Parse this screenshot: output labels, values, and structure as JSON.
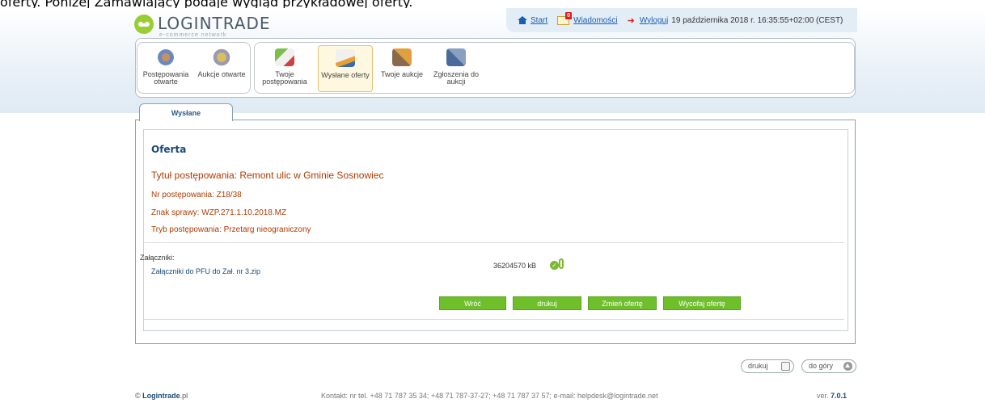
{
  "caption": "oferty. Poniżej Zamawiający podaje wygląd przykładowej oferty.",
  "logo": {
    "name": "LOGINTRADE",
    "tagline": "e-commerce network"
  },
  "top_links": {
    "start": "Start",
    "messages": "Wiadomości",
    "messages_count": "0",
    "logout": "Wyloguj",
    "datetime": "19 października 2018 r. 16:35:55+02:00 (CEST)"
  },
  "toolbar": {
    "group1": [
      {
        "label": "Postępowania otwarte",
        "icon": "open-procedures-icon"
      },
      {
        "label": "Aukcje otwarte",
        "icon": "open-auctions-icon"
      }
    ],
    "group2": [
      {
        "label": "Twoje postępowania",
        "icon": "my-procedures-icon"
      },
      {
        "label": "Wysłane oferty",
        "icon": "sent-offers-icon"
      },
      {
        "label": "Twoje aukcje",
        "icon": "my-auctions-icon"
      },
      {
        "label": "Zgłoszenia do aukcji",
        "icon": "auction-submissions-icon"
      }
    ]
  },
  "tab": "Wysłane",
  "offer": {
    "section_title": "Oferta",
    "title": "Tytuł postępowania: Remont ulic w Gminie Sosnowiec",
    "number": "Nr postępowania: Z18/38",
    "case_sign": "Znak sprawy: WZP.271.1.10.2018.MZ",
    "mode": "Tryb postępowania: Przetarg nieograniczony",
    "attachments_label": "Załączniki:",
    "attachment_name": "Załączniki do PFU do Zał. nr 3.zip",
    "attachment_size": "36204570 kB"
  },
  "buttons": {
    "back": "Wróć",
    "print": "drukuj",
    "change": "Zmień ofertę",
    "withdraw": "Wycofaj ofertę"
  },
  "bottom_tools": {
    "print": "drukuj",
    "top": "do góry"
  },
  "footer": {
    "brand": "Logintrade",
    "domain": ".pl",
    "copyright_symbol": "©",
    "contact": "Kontakt: nr tel. +48 71 787 35 34; +48 71 787-37-27; +48 71 787 37 57; e-mail: helpdesk@logintrade.net",
    "version_label": "ver.",
    "version": "7.0.1"
  },
  "colors": {
    "accent_green": "#6fbf2a",
    "title_orange": "#b03a00",
    "link_blue": "#1a4a7a"
  }
}
